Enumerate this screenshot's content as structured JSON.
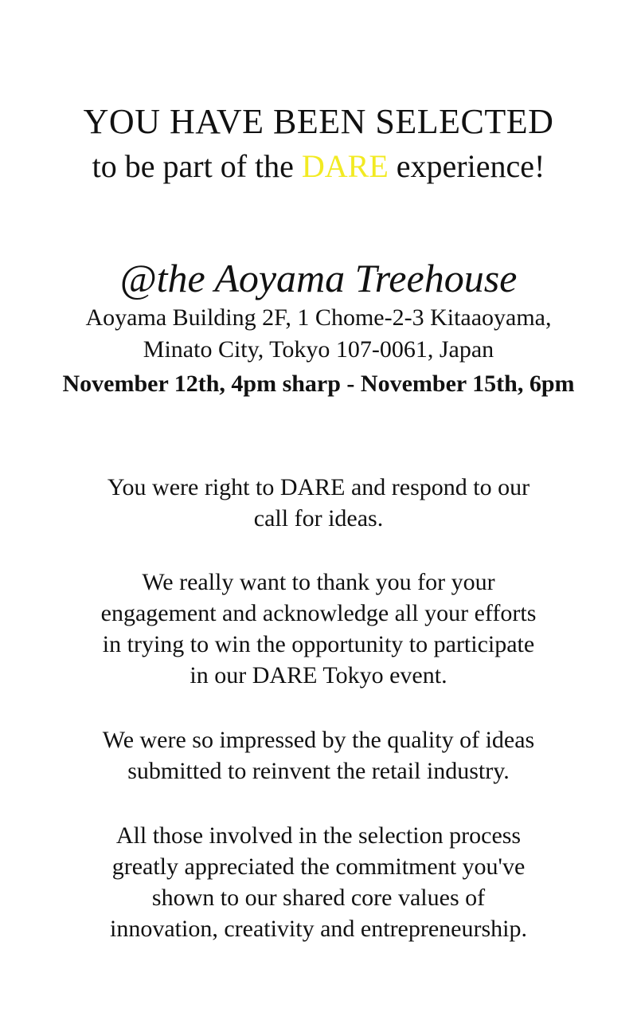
{
  "header": {
    "headline": "YOU HAVE BEEN SELECTED",
    "subline_prefix": "to be part of  the ",
    "subline_brand": "DARE",
    "subline_suffix": " experience!"
  },
  "venue": {
    "name": "@the Aoyama Treehouse",
    "address_line1": "Aoyama Building 2F, 1 Chome-2-3 Kitaaoyama,",
    "address_line2": "Minato City, Tokyo 107-0061, Japan",
    "dates": "November 12th, 4pm sharp - November 15th, 6pm"
  },
  "message": {
    "p1": [
      "You were right to DARE and respond to our",
      "call for ideas."
    ],
    "p2": [
      "We really want to thank you for your",
      "engagement and acknowledge all your efforts",
      "in trying to win the opportunity to participate",
      "in our DARE Tokyo event."
    ],
    "p3": [
      "We were so impressed by the quality of  ideas",
      "submitted to reinvent the retail industry."
    ],
    "p4": [
      "All those involved in the selection process",
      "greatly appreciated the commitment you've",
      "shown to our shared core values of",
      "innovation, creativity and entrepreneurship."
    ]
  },
  "colors": {
    "accent": "#f2ea22",
    "text": "#111111",
    "background": "#ffffff"
  }
}
